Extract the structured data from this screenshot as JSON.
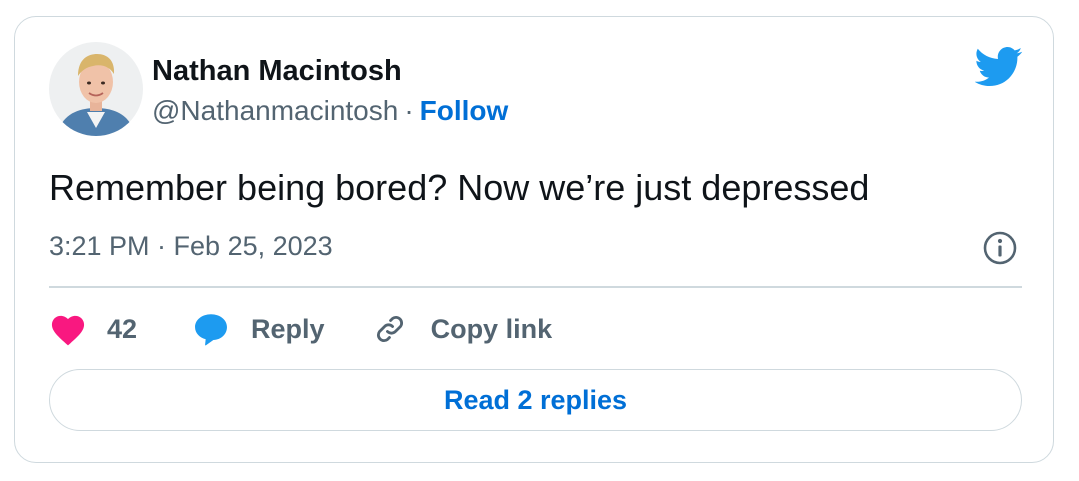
{
  "author": {
    "name": "Nathan Macintosh",
    "handle": "@Nathanmacintosh",
    "separator": "·",
    "follow_label": "Follow"
  },
  "tweet": {
    "text": "Remember being bored? Now we’re just depressed",
    "timestamp": "3:21 PM · Feb 25, 2023"
  },
  "actions": {
    "like_count": "42",
    "reply_label": "Reply",
    "copy_link_label": "Copy link"
  },
  "read_replies_label": "Read 2 replies",
  "icons": {
    "brand": "twitter-bird-icon",
    "info": "info-icon",
    "like": "heart-icon",
    "reply": "speech-bubble-icon",
    "copy": "link-icon"
  },
  "colors": {
    "twitter_blue": "#1d9bf0",
    "link_blue": "#006fd6",
    "like_pink": "#f91880",
    "text_primary": "#0f1419",
    "text_secondary": "#536471",
    "border": "#cfd9de"
  }
}
